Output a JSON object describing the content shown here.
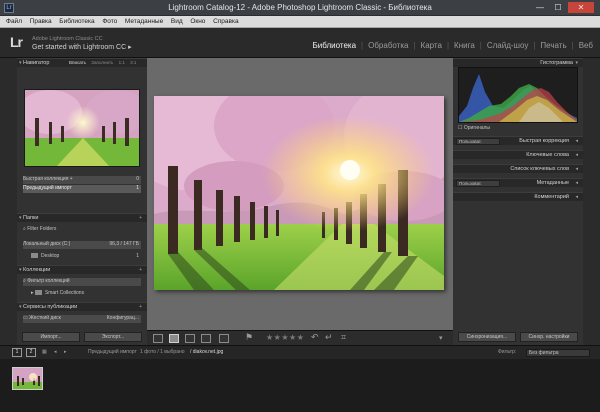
{
  "window": {
    "title": "Lightroom Catalog-12 - Adobe Photoshop Lightroom Classic - Библиотека",
    "app_icon": "Lr",
    "minimize": "—",
    "maximize": "☐",
    "close": "✕"
  },
  "menu": [
    "Файл",
    "Правка",
    "Библиотека",
    "Фото",
    "Метаданные",
    "Вид",
    "Окно",
    "Справка"
  ],
  "identity": {
    "logo": "Lr",
    "line1": "Adobe Lightroom Classic CC",
    "line2": "Get started with Lightroom CC ▸"
  },
  "modules": [
    "Библиотека",
    "Обработка",
    "Карта",
    "Книга",
    "Слайд-шоу",
    "Печать",
    "Веб"
  ],
  "module_separator": "|",
  "left_panel": {
    "navigator": {
      "title": "Навигатор",
      "options": [
        "Вписать",
        "Заполнить",
        "1:1",
        "3:1"
      ],
      "active_option": "Вписать"
    },
    "catalog_rows": [
      {
        "label": "Быстрая коллекция  +",
        "count": "0"
      },
      {
        "label": "Предыдущий импорт",
        "count": "1"
      }
    ],
    "folders": {
      "title": "Папки",
      "filter": "Filter Folders",
      "disk": "Локальный диск (C:)",
      "disk_size": "96,3 / 147 ГБ",
      "folder": "Desktop",
      "folder_count": "1"
    },
    "collections": {
      "title": "Коллекции",
      "filter": "Фильтр коллекций",
      "smart": "Smart Collections"
    },
    "publish": {
      "title": "Сервисы публикации",
      "service": "Жесткий диск",
      "setup": "Конфигурац..."
    },
    "import_button": "Импорт...",
    "export_button": "Экспорт..."
  },
  "right_panel": {
    "histogram_title": "Гистограмма",
    "original_checkbox": "Оригиналы",
    "quick_develop": {
      "preset": "Пользоват.",
      "title": "Быстрая коррекция"
    },
    "keywords": "Ключевые слова",
    "keyword_list": "Список ключевых слов",
    "metadata": {
      "preset": "Пользоват.",
      "title": "Метаданные"
    },
    "comments": "Комментарий",
    "sync_metadata_button": "Синхронизация...",
    "sync_settings_button": "Синхр. настройки"
  },
  "toolbar": {
    "stars": "★★★★★"
  },
  "filmstrip_bar": {
    "page1": "1",
    "page2": "2",
    "source": "Предыдущий импорт",
    "counts": "1 фото  /  1 выбрано",
    "filename": "/ diakov.net.jpg",
    "filter_label": "Фильтр:",
    "filter_value": "Без фильтра"
  },
  "colors": {
    "panel": "#323232",
    "center_bg": "#6a6a6a",
    "blossom": "#d9a7c4",
    "grass": "#7ac23a",
    "sun": "#fff2b0"
  },
  "icons": [
    "grid-view-icon",
    "loupe-view-icon",
    "compare-view-icon",
    "survey-view-icon",
    "people-view-icon",
    "rotate-left-icon",
    "rotate-right-icon",
    "crop-icon"
  ]
}
